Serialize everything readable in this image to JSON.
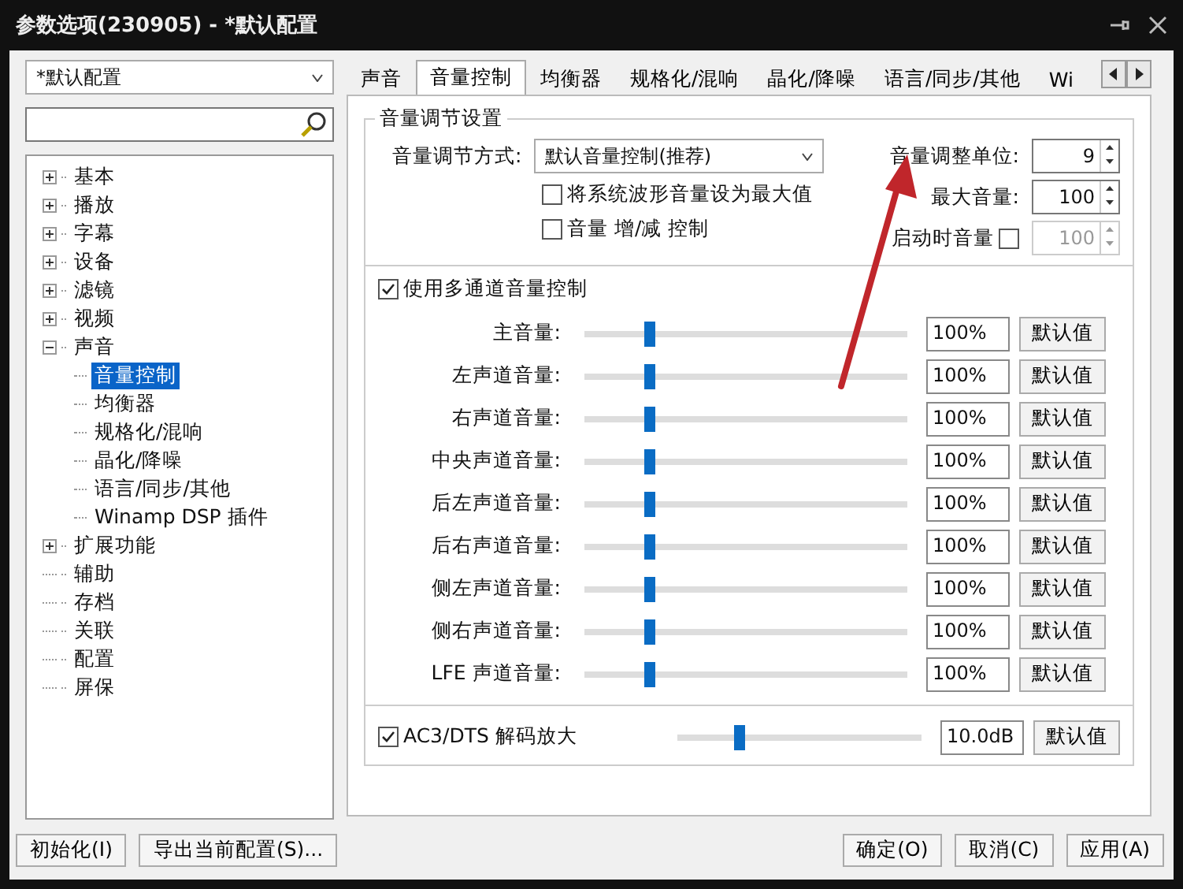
{
  "window": {
    "title": "参数选项(230905) - *默认配置"
  },
  "profile_select": {
    "value": "*默认配置"
  },
  "tree": [
    {
      "label": "基本",
      "kind": "group",
      "expanded": false,
      "selected": false
    },
    {
      "label": "播放",
      "kind": "group",
      "expanded": false,
      "selected": false
    },
    {
      "label": "字幕",
      "kind": "group",
      "expanded": false,
      "selected": false
    },
    {
      "label": "设备",
      "kind": "group",
      "expanded": false,
      "selected": false
    },
    {
      "label": "滤镜",
      "kind": "group",
      "expanded": false,
      "selected": false
    },
    {
      "label": "视频",
      "kind": "group",
      "expanded": false,
      "selected": false
    },
    {
      "label": "声音",
      "kind": "group",
      "expanded": true,
      "selected": false,
      "children": [
        {
          "label": "音量控制",
          "selected": true
        },
        {
          "label": "均衡器",
          "selected": false
        },
        {
          "label": "规格化/混响",
          "selected": false
        },
        {
          "label": "晶化/降噪",
          "selected": false
        },
        {
          "label": "语言/同步/其他",
          "selected": false
        },
        {
          "label": "Winamp DSP 插件",
          "selected": false
        }
      ]
    },
    {
      "label": "扩展功能",
      "kind": "group",
      "expanded": false,
      "selected": false
    },
    {
      "label": "辅助",
      "kind": "item",
      "selected": false
    },
    {
      "label": "存档",
      "kind": "item",
      "selected": false
    },
    {
      "label": "关联",
      "kind": "item",
      "selected": false
    },
    {
      "label": "配置",
      "kind": "item",
      "selected": false
    },
    {
      "label": "屏保",
      "kind": "item",
      "selected": false
    }
  ],
  "tabs": [
    {
      "label": "声音",
      "selected": false
    },
    {
      "label": "音量控制",
      "selected": true
    },
    {
      "label": "均衡器",
      "selected": false
    },
    {
      "label": "规格化/混响",
      "selected": false
    },
    {
      "label": "晶化/降噪",
      "selected": false
    },
    {
      "label": "语言/同步/其他",
      "selected": false
    },
    {
      "label": "Wi",
      "selected": false
    }
  ],
  "group": {
    "title": "音量调节设置",
    "mode_label": "音量调节方式:",
    "mode_value": "默认音量控制(推荐)",
    "checkboxes": [
      {
        "label": "将系统波形音量设为最大值",
        "checked": false
      },
      {
        "label": "音量 增/减 控制",
        "checked": false
      }
    ],
    "spinners": [
      {
        "label": "音量调整单位:",
        "value": "9",
        "disabled": false
      },
      {
        "label": "最大音量:",
        "value": "100",
        "disabled": false
      }
    ],
    "startup": {
      "label": "启动时音量",
      "checked": false,
      "value": "100",
      "disabled": true
    },
    "multichannel": {
      "label": "使用多通道音量控制",
      "checked": true
    },
    "channels": [
      {
        "name": "主音量:",
        "level": 0.2,
        "value": "100%",
        "button": "默认值"
      },
      {
        "name": "左声道音量:",
        "level": 0.2,
        "value": "100%",
        "button": "默认值"
      },
      {
        "name": "右声道音量:",
        "level": 0.2,
        "value": "100%",
        "button": "默认值"
      },
      {
        "name": "中央声道音量:",
        "level": 0.2,
        "value": "100%",
        "button": "默认值"
      },
      {
        "name": "后左声道音量:",
        "level": 0.2,
        "value": "100%",
        "button": "默认值"
      },
      {
        "name": "后右声道音量:",
        "level": 0.2,
        "value": "100%",
        "button": "默认值"
      },
      {
        "name": "侧左声道音量:",
        "level": 0.2,
        "value": "100%",
        "button": "默认值"
      },
      {
        "name": "侧右声道音量:",
        "level": 0.2,
        "value": "100%",
        "button": "默认值"
      },
      {
        "name": "LFE 声道音量:",
        "level": 0.2,
        "value": "100%",
        "button": "默认值"
      }
    ],
    "ac3": {
      "label": "AC3/DTS 解码放大",
      "checked": true,
      "level": 0.25,
      "value": "10.0dB",
      "button": "默认值"
    }
  },
  "footer_left": [
    "初始化(I)",
    "导出当前配置(S)..."
  ],
  "footer_right": [
    "确定(O)",
    "取消(C)",
    "应用(A)"
  ]
}
